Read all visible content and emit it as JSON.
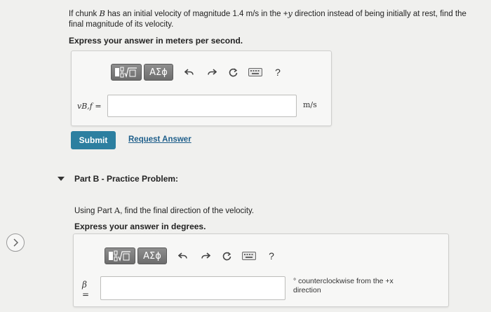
{
  "part_a": {
    "question_pre": "If chunk ",
    "question_var": "B",
    "question_mid": " has an initial velocity of magnitude 1.4 m/s in the +",
    "question_var2": "y",
    "question_post": " direction instead of being initially at rest, find the final magnitude of its velocity.",
    "instruction": "Express your answer in meters per second.",
    "variable": "vB,f =",
    "input_value": "",
    "unit": "m/s",
    "submit_label": "Submit",
    "request_label": "Request Answer"
  },
  "toolbar": {
    "templates_icon": "fraction-sqrt-icon",
    "symbols_label": "ΑΣϕ",
    "undo_icon": "undo-icon",
    "redo_icon": "redo-icon",
    "reset_icon": "reset-icon",
    "keyboard_icon": "keyboard-icon",
    "help_label": "?"
  },
  "part_b": {
    "title": "Part B - Practice Problem:",
    "question_pre": "Using Part ",
    "question_var": "A",
    "question_post": ", find the final direction of the velocity.",
    "instruction": "Express your answer in degrees.",
    "variable": "β =",
    "input_value": "",
    "unit_line1": "° counterclockwise from the +x",
    "unit_line2": "direction"
  },
  "nav": {
    "next_icon": "chevron-right-icon"
  }
}
